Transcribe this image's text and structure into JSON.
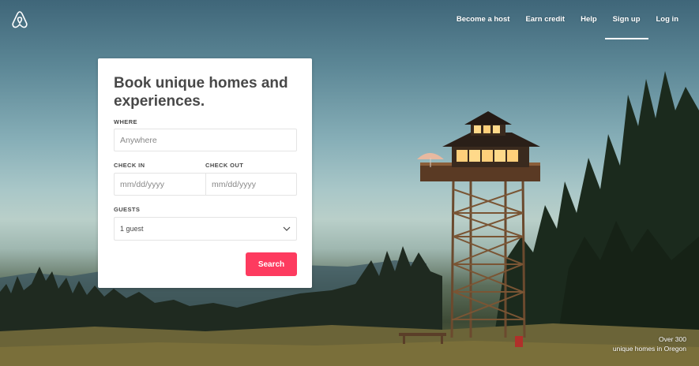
{
  "nav": {
    "logo_icon": "airbnb-logo-icon",
    "items": [
      {
        "label": "Become a host"
      },
      {
        "label": "Earn credit"
      },
      {
        "label": "Help"
      },
      {
        "label": "Sign up",
        "active": true
      },
      {
        "label": "Log in"
      }
    ]
  },
  "search_card": {
    "title": "Book unique homes and experiences.",
    "where": {
      "label": "WHERE",
      "placeholder": "Anywhere",
      "value": ""
    },
    "check_in": {
      "label": "CHECK IN",
      "placeholder": "mm/dd/yyyy"
    },
    "check_out": {
      "label": "CHECK OUT",
      "placeholder": "mm/dd/yyyy"
    },
    "guests": {
      "label": "GUESTS",
      "selected": "1 guest",
      "icon": "chevron-down-icon"
    },
    "search_label": "Search",
    "accent_color": "#fd3b5f"
  },
  "caption": {
    "line1": "Over 300",
    "line2": "unique homes in Oregon"
  },
  "colors": {
    "text_dark": "#484848",
    "brand": "#ff5a5f"
  }
}
